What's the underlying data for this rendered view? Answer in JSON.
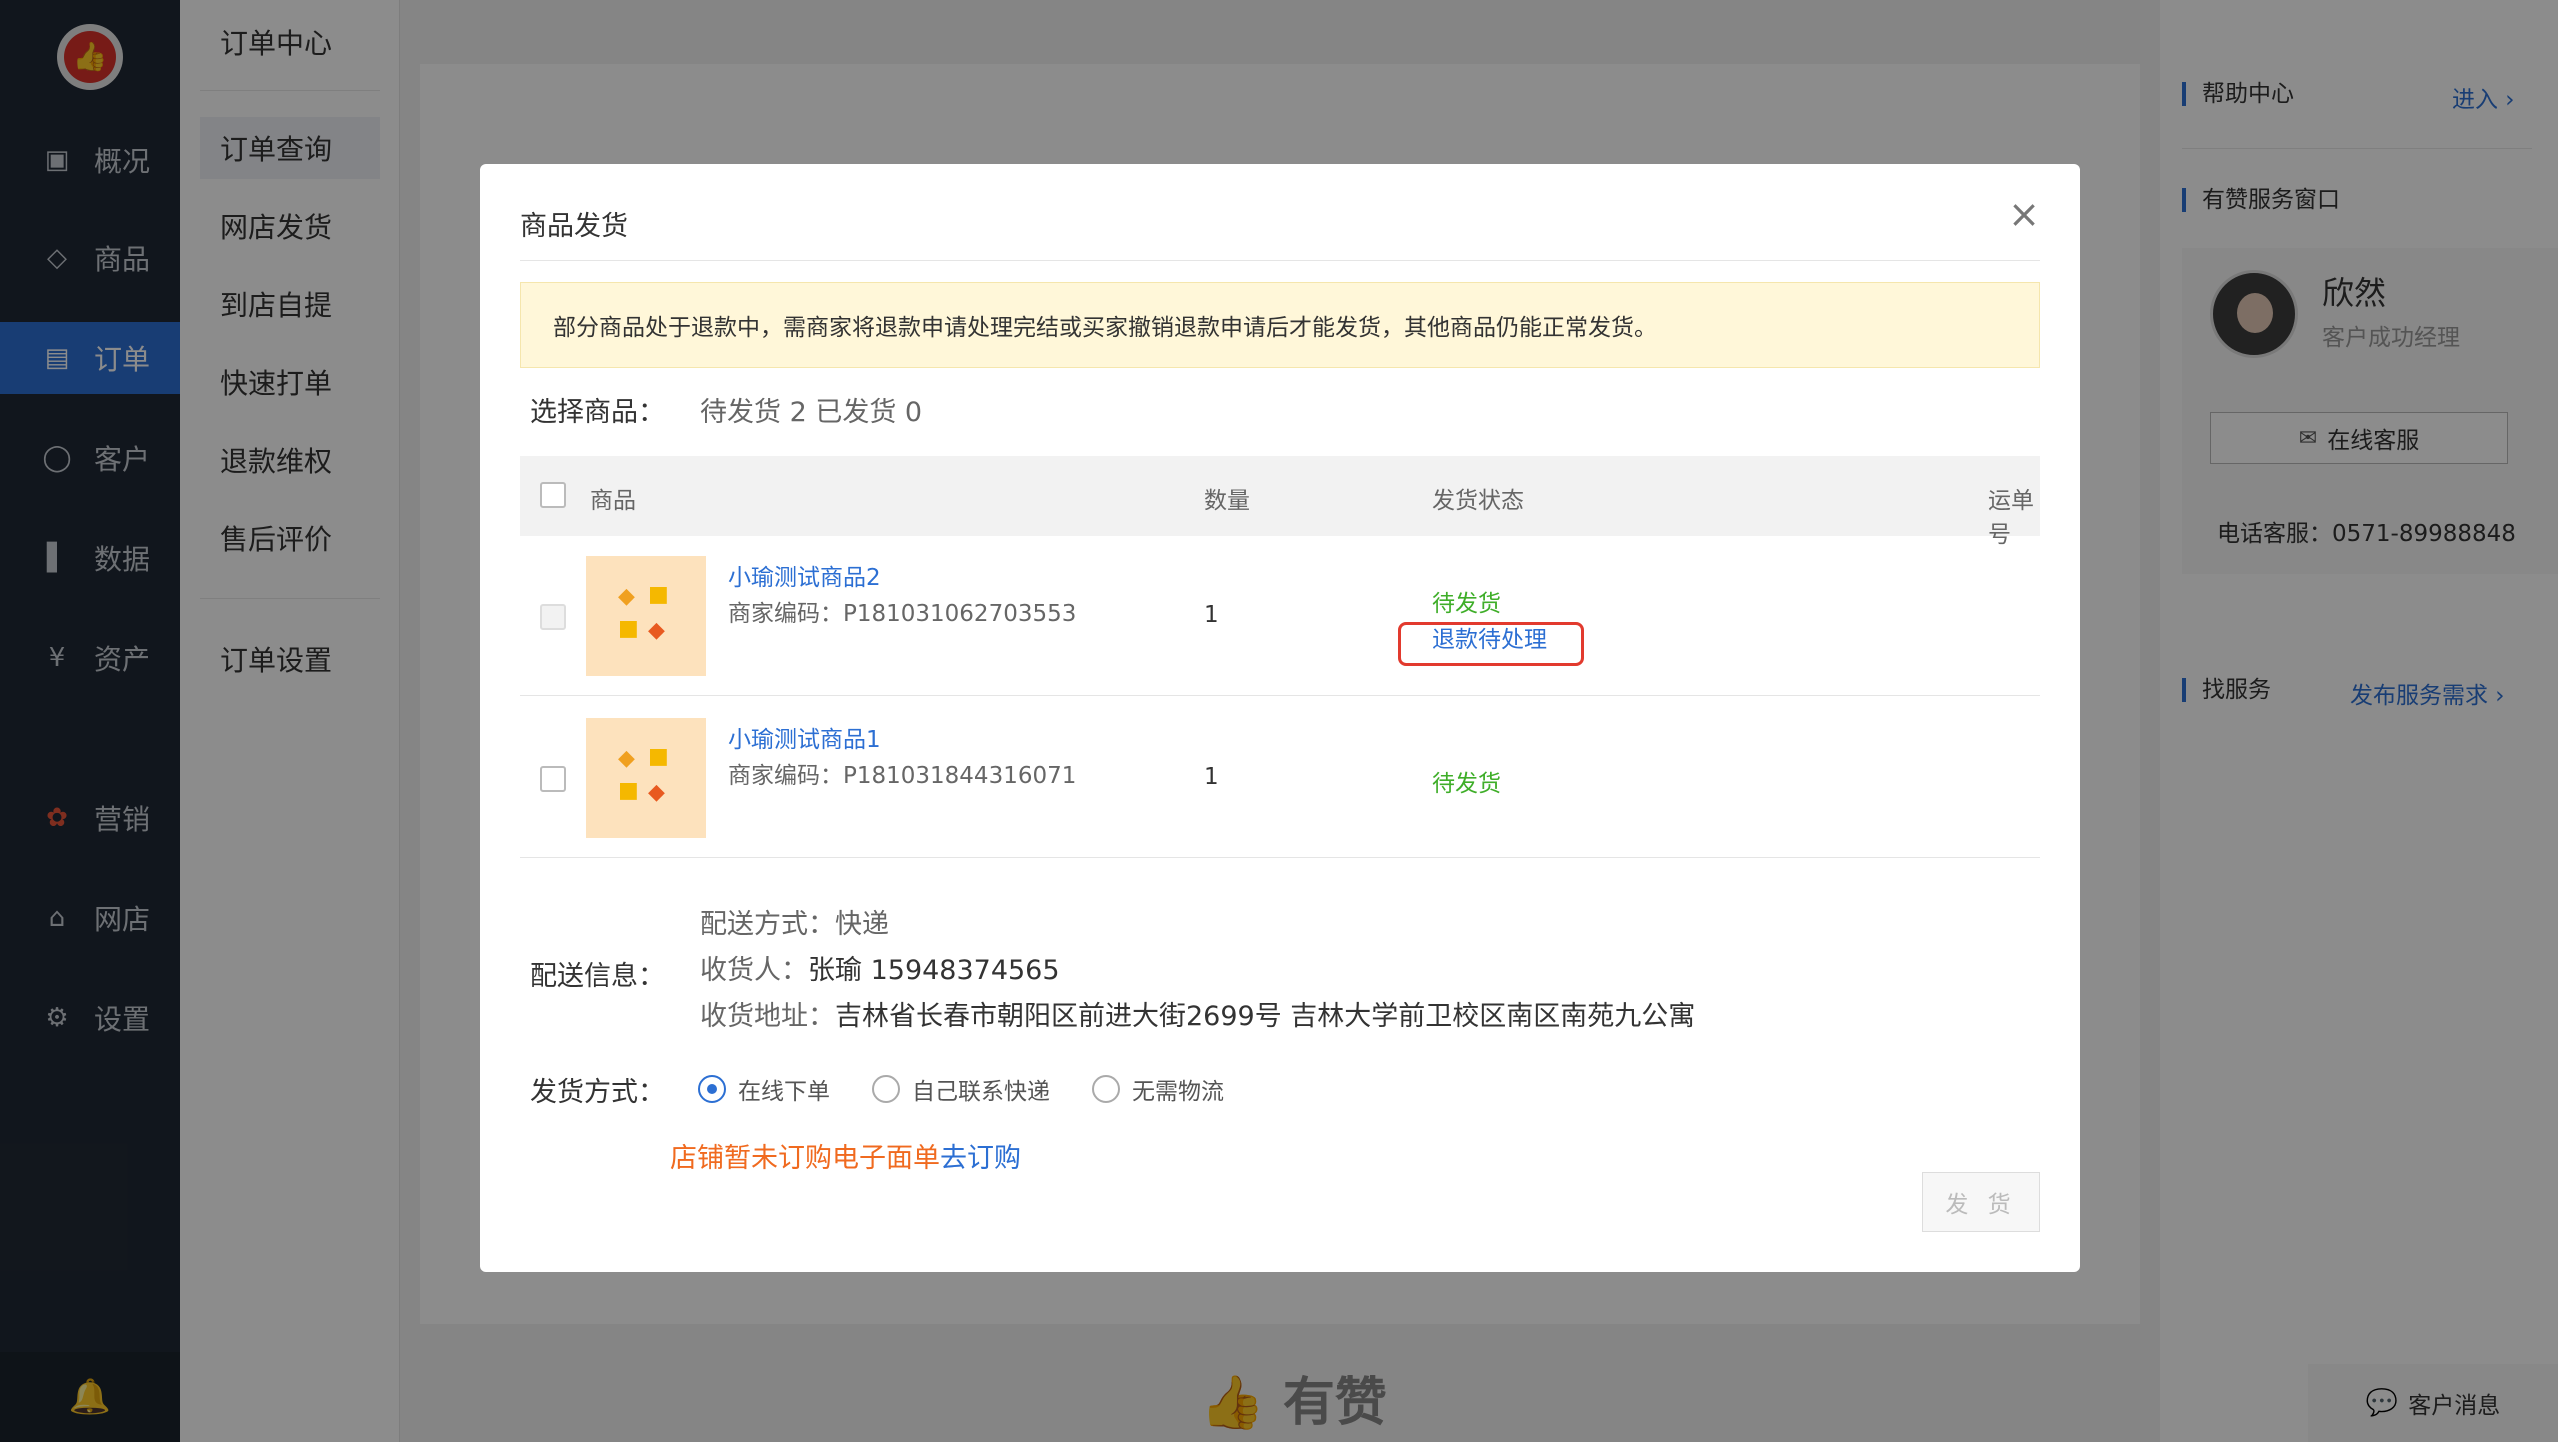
{
  "sidebar": {
    "logo_icon": "thumbs-up-icon",
    "items": [
      {
        "label": "概况",
        "icon": "dashboard-icon"
      },
      {
        "label": "商品",
        "icon": "tag-icon"
      },
      {
        "label": "订单",
        "icon": "order-icon"
      },
      {
        "label": "客户",
        "icon": "user-icon"
      },
      {
        "label": "数据",
        "icon": "chart-icon"
      },
      {
        "label": "资产",
        "icon": "yen-icon"
      },
      {
        "label": "营销",
        "icon": "marketing-icon"
      },
      {
        "label": "网店",
        "icon": "store-icon"
      },
      {
        "label": "设置",
        "icon": "gear-icon"
      }
    ],
    "active": "订单",
    "bell_icon": "bell-icon"
  },
  "subnav": {
    "title": "订单中心",
    "items": [
      "订单查询",
      "网店发货",
      "到店自提",
      "快速打单",
      "退款维权",
      "售后评价",
      "订单设置"
    ],
    "active": "订单查询"
  },
  "right_panel": {
    "help_center": "帮助中心",
    "help_link": "进入",
    "service_window": "有赞服务窗口",
    "agent_name": "欣然",
    "agent_role": "客户成功经理",
    "online_service": "在线客服",
    "phone": "电话客服：0571-89988848",
    "find_service": "找服务",
    "publish_link": "发布服务需求",
    "chat": "客户消息"
  },
  "footer_brand": "有赞",
  "modal": {
    "title": "商品发货",
    "close": "×",
    "notice": "部分商品处于退款中，需商家将退款申请处理完结或买家撤销退款申请后才能发货，其他商品仍能正常发货。",
    "select_label": "选择商品：",
    "select_summary": "待发货 2 已发货 0",
    "columns": {
      "product": "商品",
      "qty": "数量",
      "status": "发货状态",
      "tracking": "运单号"
    },
    "rows": [
      {
        "name": "小瑜测试商品2",
        "code": "商家编码：P181031062703553",
        "qty": "1",
        "status": "待发货",
        "refund": "退款待处理",
        "checkbox_disabled": true
      },
      {
        "name": "小瑜测试商品1",
        "code": "商家编码：P181031844316071",
        "qty": "1",
        "status": "待发货",
        "refund": "",
        "checkbox_disabled": false
      }
    ],
    "delivery_label": "配送信息：",
    "delivery": {
      "method_label": "配送方式：",
      "method": "快递",
      "receiver_label": "收货人：",
      "receiver": "张瑜 15948374565",
      "address_label": "收货地址：",
      "address": "吉林省长春市朝阳区前进大街2699号 吉林大学前卫校区南区南苑九公寓"
    },
    "ship_method_label": "发货方式：",
    "ship_options": [
      "在线下单",
      "自己联系快递",
      "无需物流"
    ],
    "ship_selected": "在线下单",
    "warn_text": "店铺暂未订购电子面单",
    "warn_link": "去订购",
    "ship_button": "发 货"
  }
}
